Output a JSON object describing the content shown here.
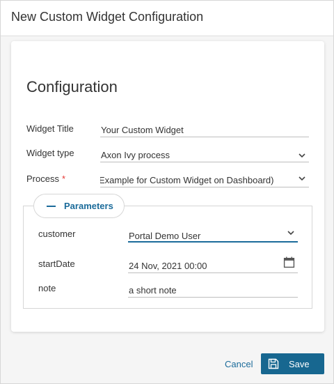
{
  "dialog": {
    "title": "New Custom Widget Configuration"
  },
  "config": {
    "heading": "Configuration",
    "widget_title": {
      "label": "Widget Title",
      "value": "Your Custom Widget"
    },
    "widget_type": {
      "label": "Widget type",
      "value": "Axon Ivy process"
    },
    "process": {
      "label": "Process",
      "required_mark": "*",
      "value": "Example for Custom Widget on Dashboard)"
    }
  },
  "parameters": {
    "toggle_label": "Parameters",
    "customer": {
      "label": "customer",
      "value": "Portal Demo User"
    },
    "start_date": {
      "label": "startDate",
      "value": "24 Nov, 2021 00:00"
    },
    "note": {
      "label": "note",
      "value": "a short note"
    }
  },
  "footer": {
    "cancel_label": "Cancel",
    "save_label": "Save"
  },
  "colors": {
    "accent": "#1b6b9a",
    "save_bg": "#176790",
    "required": "#e53935"
  }
}
